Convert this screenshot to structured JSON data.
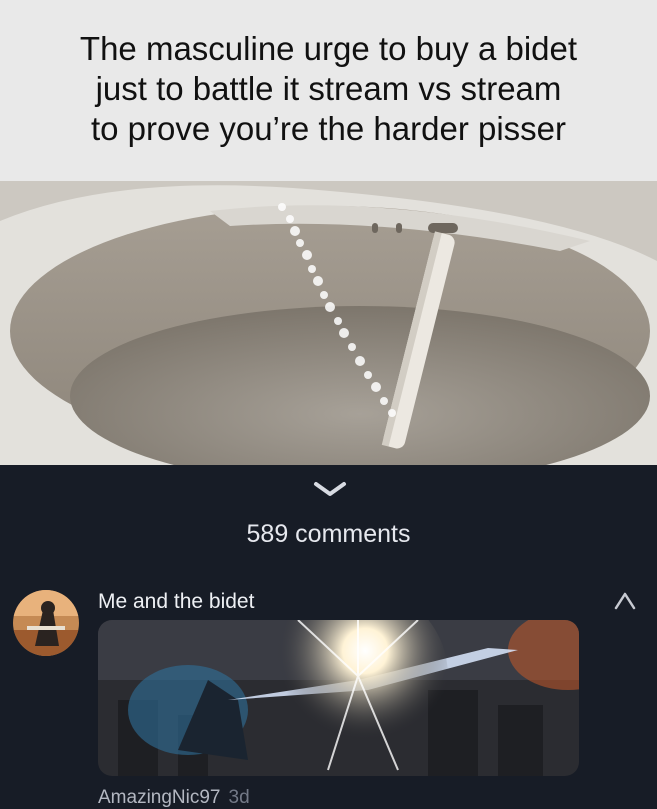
{
  "meme": {
    "caption": "The masculine urge to buy a bidet\njust to battle it stream vs stream\nto prove you’re the harder pisser"
  },
  "post": {
    "comments_count_label": "589 comments"
  },
  "comment": {
    "text": "Me and the bidet",
    "username": "AmazingNic97",
    "age": "3d"
  },
  "icons": {
    "expand": "chevron-down-icon",
    "collapse": "collapse-icon"
  },
  "colors": {
    "background": "#171c26",
    "caption_bg": "#e9e9e9",
    "text_primary": "#eef0f4",
    "text_secondary": "#9aa0ac"
  }
}
